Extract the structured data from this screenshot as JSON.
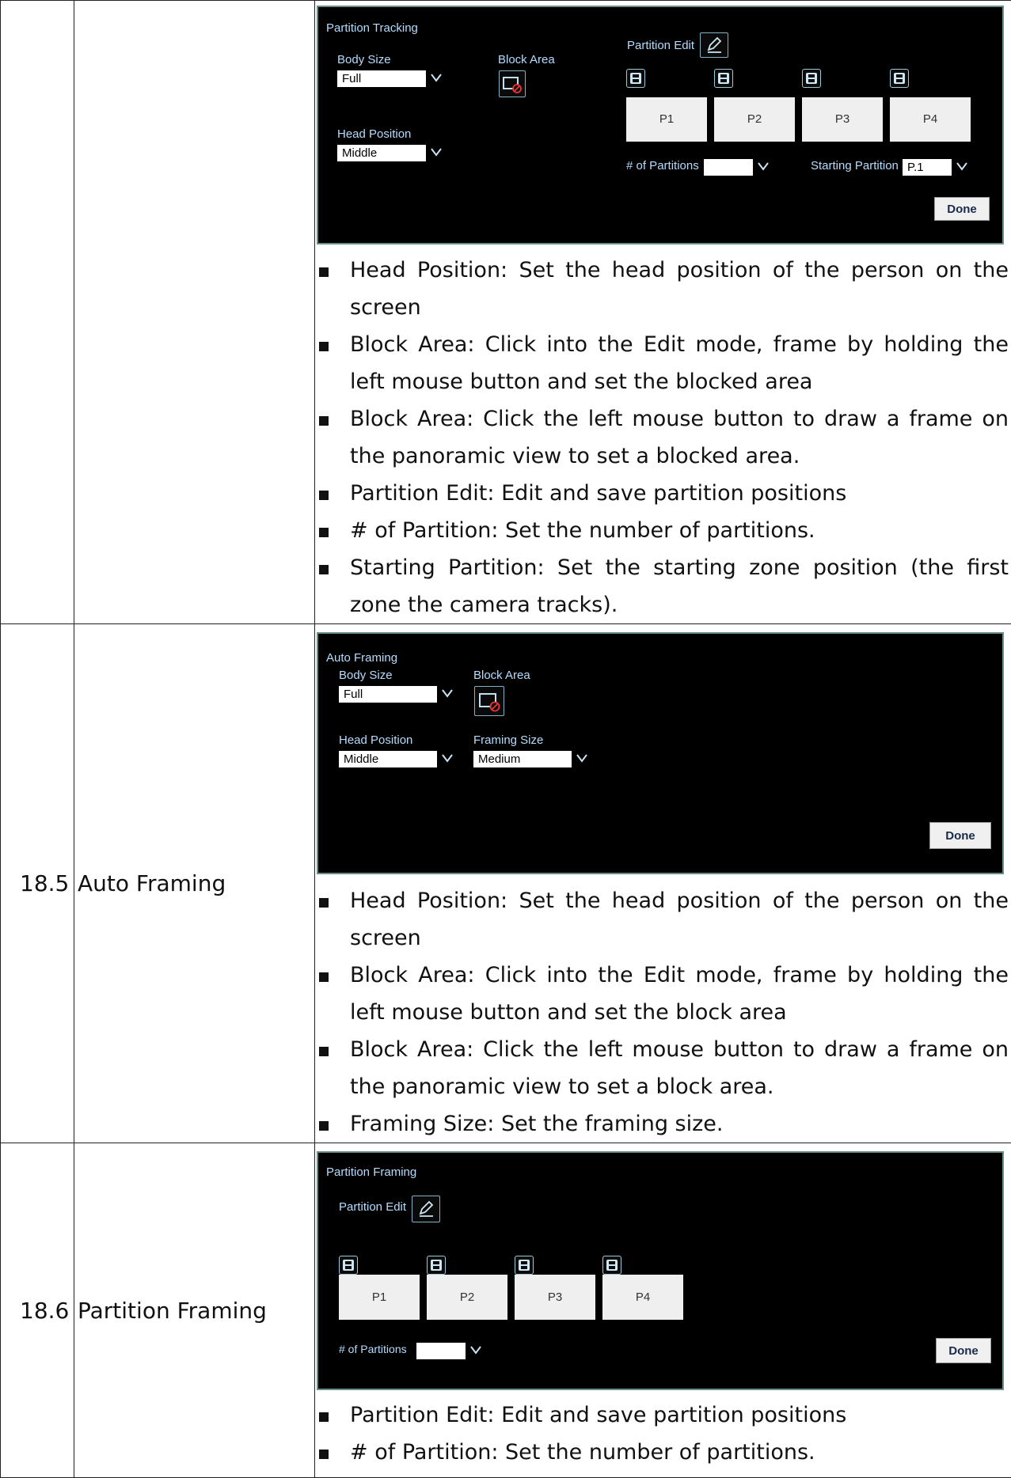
{
  "rows": [
    {
      "number": "",
      "name": "",
      "panel": {
        "title": "Partition Tracking",
        "body_size_label": "Body Size",
        "body_size_value": "Full",
        "block_area_label": "Block Area",
        "head_position_label": "Head Position",
        "head_position_value": "Middle",
        "partition_edit_label": "Partition Edit",
        "partitions": [
          "P1",
          "P2",
          "P3",
          "P4"
        ],
        "num_partitions_label": "# of Partitions",
        "num_partitions_value": "",
        "starting_partition_label": "Starting Partition",
        "starting_partition_value": "P.1",
        "done_label": "Done"
      },
      "bullets": [
        "Head Position: Set the head position of the person on the screen",
        "Block Area: Click into the Edit mode, frame by holding the left mouse button and set the blocked area",
        "Block Area: Click the left mouse button to draw a frame on the panoramic view to set a blocked area.",
        "Partition Edit: Edit and save partition positions",
        "# of Partition: Set the number of partitions.",
        "Starting Partition: Set the starting zone position (the first zone the camera tracks)."
      ]
    },
    {
      "number": "18.5",
      "name": "Auto Framing",
      "panel": {
        "title": "Auto Framing",
        "body_size_label": "Body Size",
        "body_size_value": "Full",
        "block_area_label": "Block Area",
        "head_position_label": "Head Position",
        "head_position_value": "Middle",
        "framing_size_label": "Framing Size",
        "framing_size_value": "Medium",
        "done_label": "Done"
      },
      "bullets": [
        "Head Position: Set the head position of the person on the screen",
        "Block Area: Click into the Edit mode, frame by holding the left mouse button and set the block area",
        "Block Area: Click the left mouse button to draw a frame on the panoramic view to set a block area.",
        "Framing Size: Set the framing size."
      ]
    },
    {
      "number": "18.6",
      "name": "Partition Framing",
      "panel": {
        "title": "Partition Framing",
        "partition_edit_label": "Partition Edit",
        "partitions": [
          "P1",
          "P2",
          "P3",
          "P4"
        ],
        "num_partitions_label": "# of Partitions",
        "num_partitions_value": "",
        "done_label": "Done"
      },
      "bullets": [
        "Partition Edit: Edit and save partition positions",
        "# of Partition: Set the number of partitions."
      ]
    }
  ],
  "icons": {
    "edit": "pencil-edit-icon",
    "block": "block-area-icon",
    "save": "save-disk-icon",
    "dropdown": "chevron-down-icon"
  }
}
